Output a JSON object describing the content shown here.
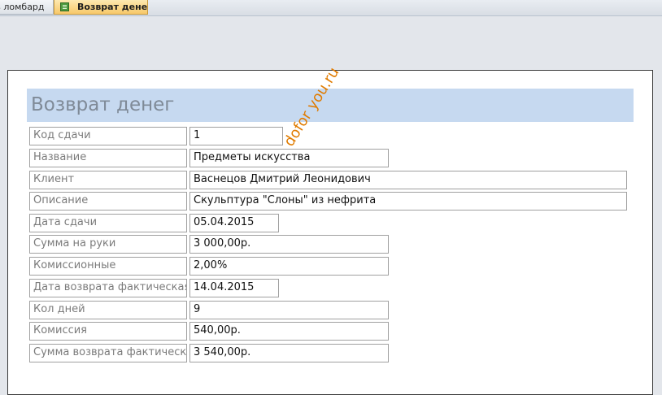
{
  "tabs": [
    {
      "label": "з ломбард",
      "active": false
    },
    {
      "label": "Возврат денег",
      "active": true
    }
  ],
  "form": {
    "title": "Возврат денег",
    "fields": [
      {
        "label": "Код сдачи",
        "value": "1"
      },
      {
        "label": "Название",
        "value": "Предметы искусства"
      },
      {
        "label": "Клиент",
        "value": "Васнецов Дмитрий Леонидович"
      },
      {
        "label": "Описание",
        "value": "Скульптура \"Слоны\" из нефрита"
      },
      {
        "label": "Дата сдачи",
        "value": "05.04.2015"
      },
      {
        "label": "Сумма на руки",
        "value": "3 000,00р."
      },
      {
        "label": "Комиссионные",
        "value": "2,00%"
      },
      {
        "label": "Дата возврата фактическая",
        "value": "14.04.2015"
      },
      {
        "label": "Кол дней",
        "value": "9"
      },
      {
        "label": "Комиссия",
        "value": "540,00р."
      },
      {
        "label": "Сумма возврата фактическая",
        "value": "3 540,00р."
      }
    ]
  },
  "watermark": "dofor you.ru",
  "colors": {
    "header_band": "#c6d9f0",
    "active_tab": "#f7c86a",
    "watermark": "#e07b00"
  }
}
